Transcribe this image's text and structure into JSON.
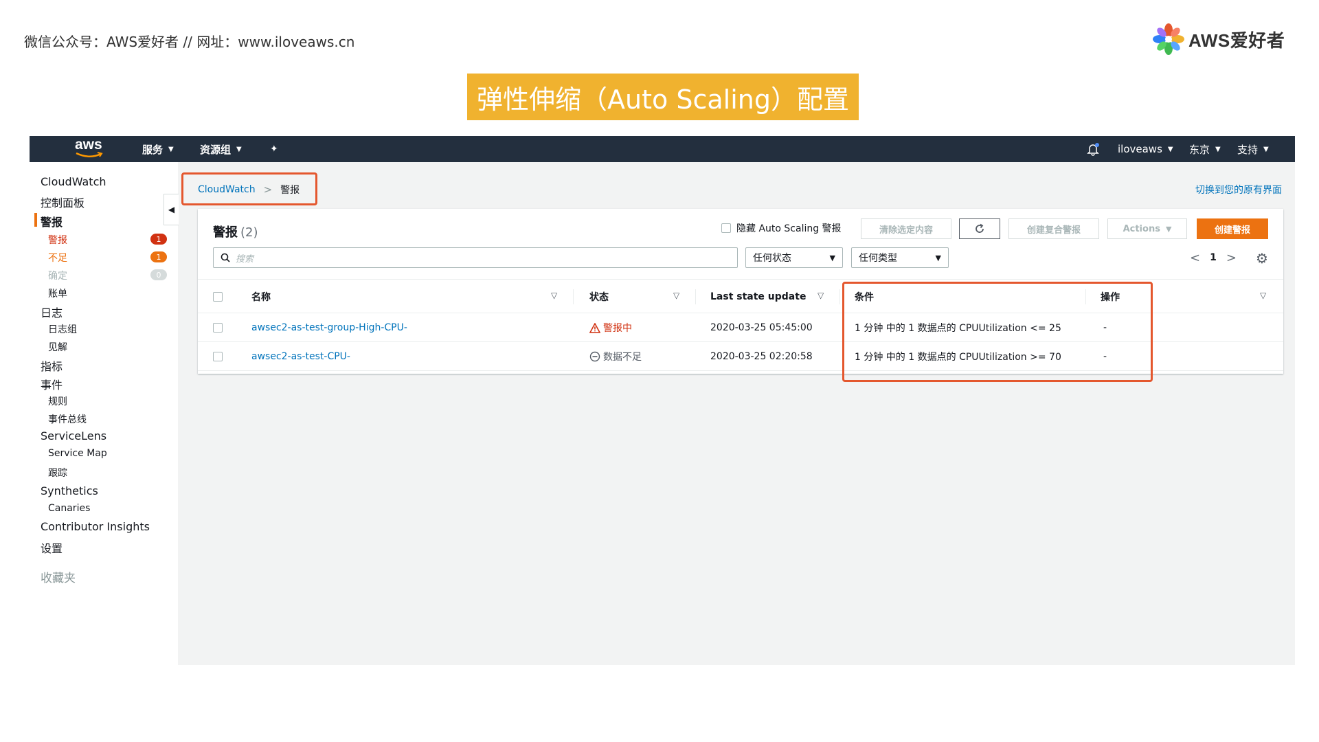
{
  "slide": {
    "caption": "微信公众号：AWS爱好者  //  网址：www.iloveaws.cn",
    "logo_text": "AWS爱好者",
    "title": "弹性伸缩（Auto Scaling）配置"
  },
  "topnav": {
    "logo": "aws",
    "services": "服务",
    "resource_groups": "资源组",
    "account": "iloveaws",
    "region": "东京",
    "support": "支持"
  },
  "sidebar": {
    "cloudwatch": "CloudWatch",
    "dashboard": "控制面板",
    "alarms": "警报",
    "alarms_in_alarm": "警报",
    "alarms_in_alarm_count": "1",
    "alarms_insufficient": "不足",
    "alarms_insufficient_count": "1",
    "alarms_ok": "确定",
    "alarms_ok_count": "0",
    "billing": "账单",
    "logs": "日志",
    "log_groups": "日志组",
    "insights": "见解",
    "metrics": "指标",
    "events": "事件",
    "rules": "规则",
    "event_buses": "事件总线",
    "servicelens": "ServiceLens",
    "service_map": "Service Map",
    "traces": "跟踪",
    "synthetics": "Synthetics",
    "canaries": "Canaries",
    "contributor_insights": "Contributor Insights",
    "settings": "设置",
    "favorites": "收藏夹"
  },
  "breadcrumb": {
    "root": "CloudWatch",
    "current": "警报"
  },
  "switch_link": "切换到您的原有界面",
  "panel": {
    "title": "警报",
    "count": "(2)",
    "hide_autoscaling_label": "隐藏 Auto Scaling 警报",
    "clear_selection": "清除选定内容",
    "create_composite": "创建复合警报",
    "actions": "Actions",
    "create_alarm": "创建警报",
    "search_placeholder": "搜索",
    "state_filter": "任何状态",
    "type_filter": "任何类型",
    "page": "1"
  },
  "table": {
    "headers": {
      "name": "名称",
      "state": "状态",
      "last_update": "Last state update",
      "conditions": "条件",
      "actions": "操作"
    },
    "rows": [
      {
        "name": "awsec2-as-test-group-High-CPU-",
        "state": "警报中",
        "last_update": "2020-03-25 05:45:00",
        "condition": "1 分钟 中的 1 数据点的 CPUUtilization <= 25",
        "actions": "-"
      },
      {
        "name": "awsec2-as-test-CPU-",
        "state": "数据不足",
        "last_update": "2020-03-25 02:20:58",
        "condition": "1 分钟 中的 1 数据点的 CPUUtilization >= 70",
        "actions": "-"
      }
    ]
  },
  "colors": {
    "title_bg": "#f0b22f",
    "nav_bg": "#232f3e",
    "accent": "#ec7211",
    "alarm_red": "#d13212",
    "link": "#0073bb",
    "highlight": "#e4572e"
  }
}
